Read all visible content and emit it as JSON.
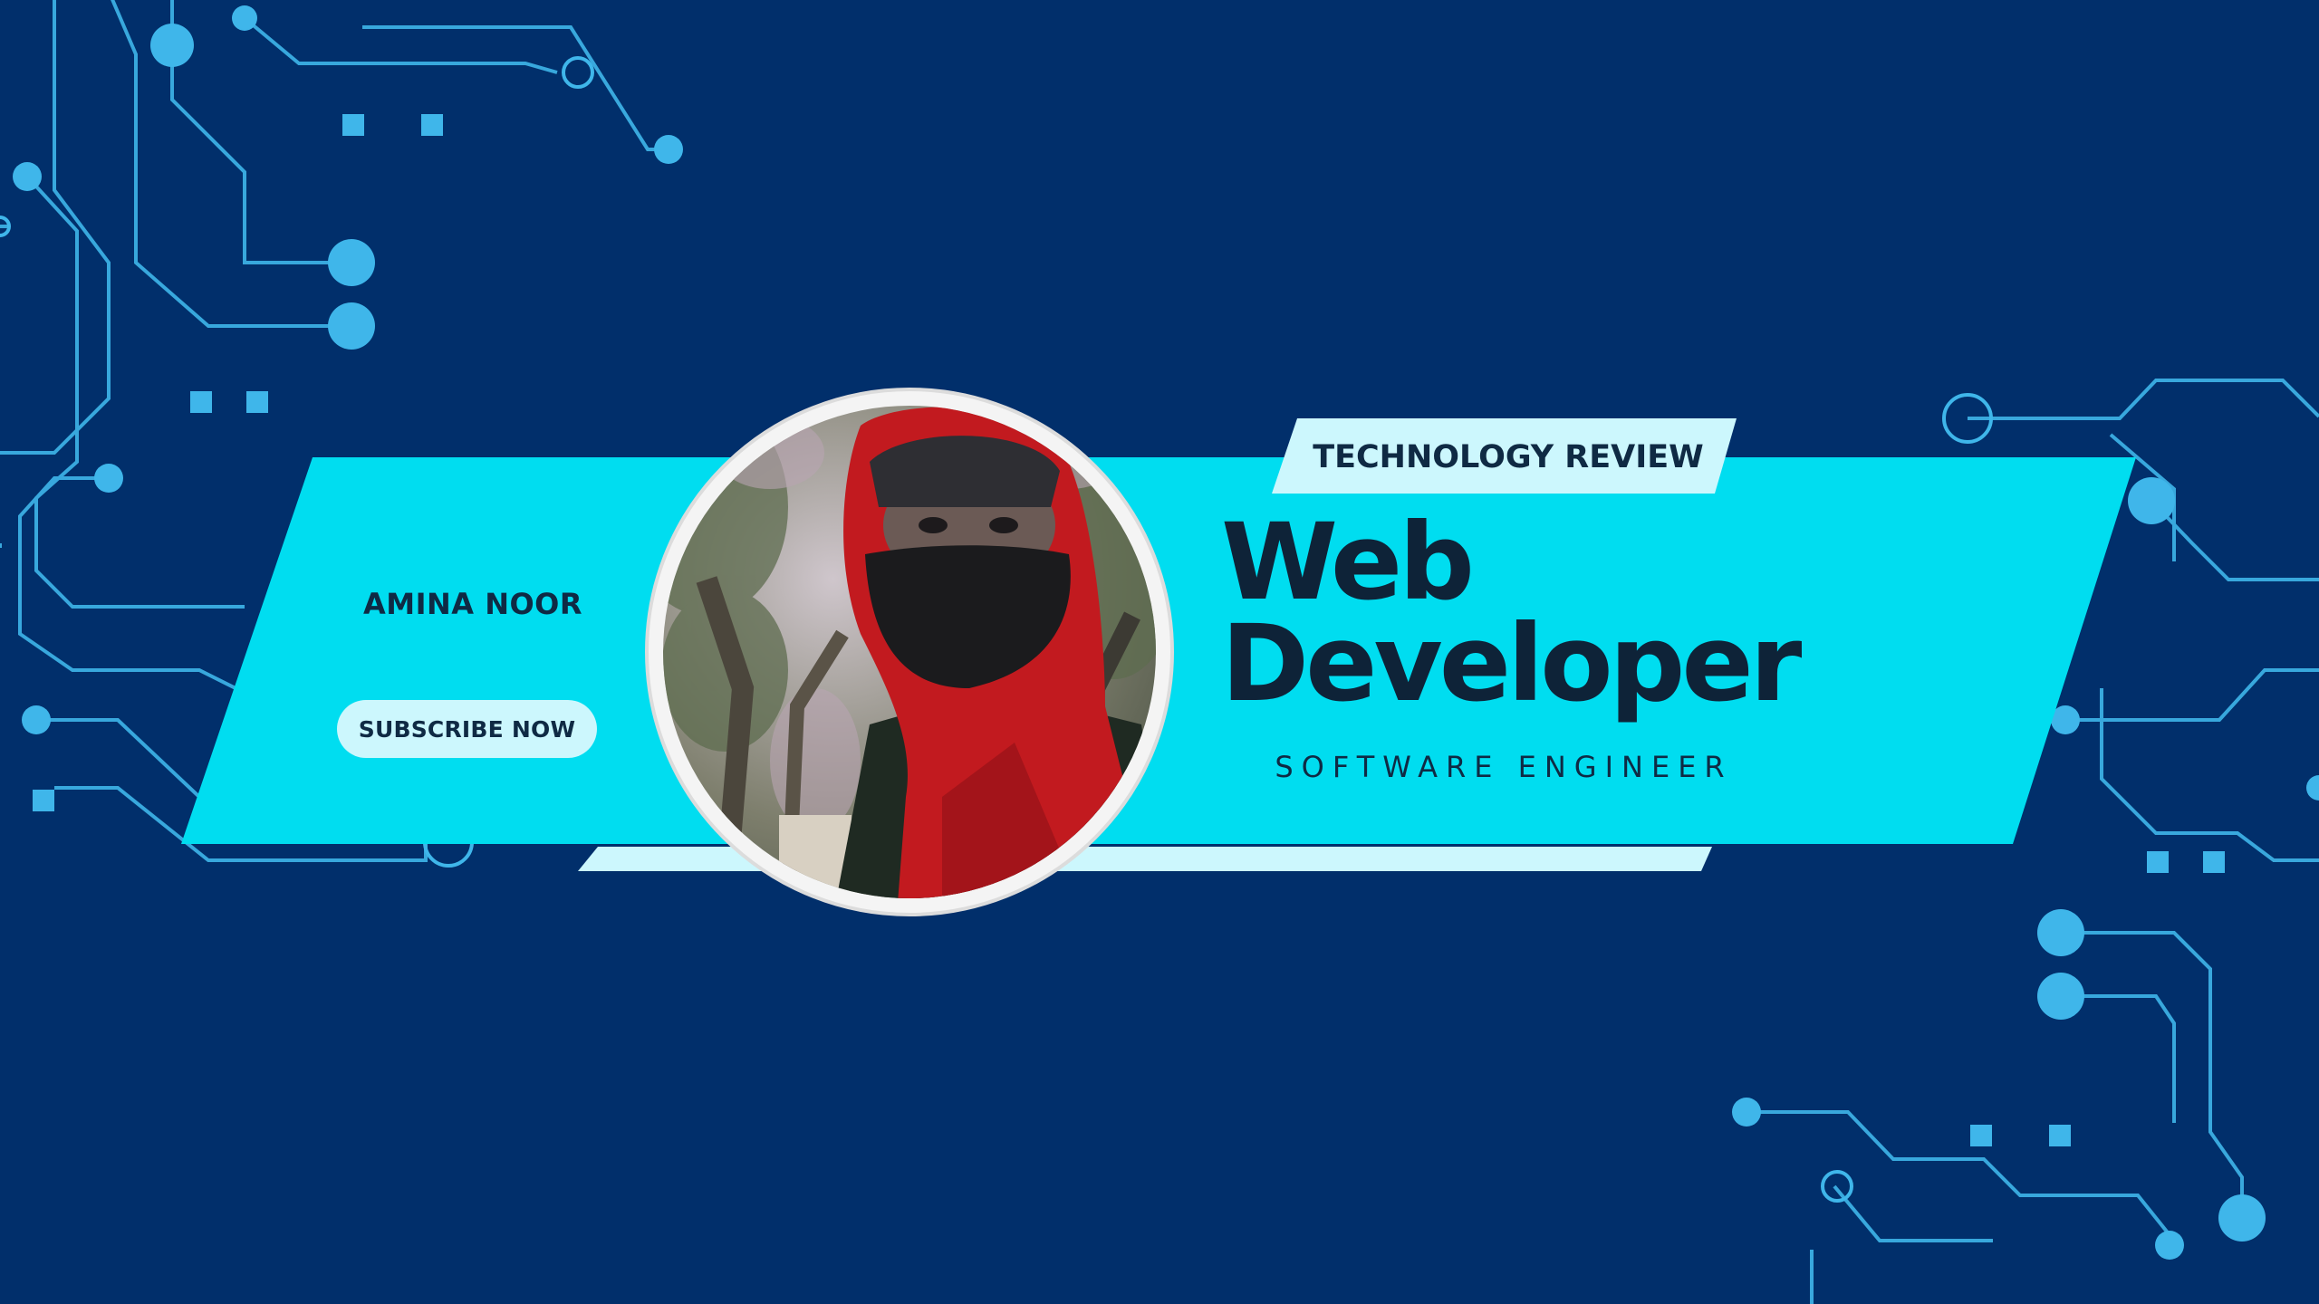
{
  "banner": {
    "channel_name": "AMINA NOOR",
    "subscribe_label": "SUBSCRIBE NOW",
    "tag": "TECHNOLOGY REVIEW",
    "headline_line1": "Web",
    "headline_line2": "Developer",
    "subtitle": "SOFTWARE ENGINEER"
  },
  "profile_photo": {
    "subject": "person wearing red hijab and black face mask, trees behind"
  },
  "colors": {
    "background": "#012f6b",
    "circuit": "#3fb6ea",
    "banner_band": "#00ddf0",
    "light_band": "#ccf7fd",
    "text_dark": "#0f2a44"
  },
  "icons": [
    "circuit-board-pattern"
  ]
}
